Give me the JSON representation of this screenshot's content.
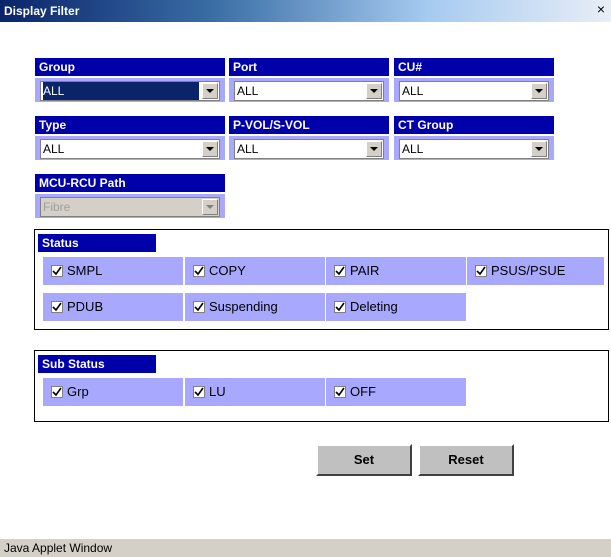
{
  "window": {
    "title": "Display Filter",
    "close_glyph": "×"
  },
  "filters": {
    "group": {
      "label": "Group",
      "value": "ALL"
    },
    "port": {
      "label": "Port",
      "value": "ALL"
    },
    "cu": {
      "label": "CU#",
      "value": "ALL"
    },
    "type": {
      "label": "Type",
      "value": "ALL"
    },
    "pvol": {
      "label": "P-VOL/S-VOL",
      "value": "ALL"
    },
    "ctgroup": {
      "label": "CT Group",
      "value": "ALL"
    },
    "mcu": {
      "label": "MCU-RCU Path",
      "value": "Fibre"
    }
  },
  "status": {
    "label": "Status",
    "items": [
      {
        "label": "SMPL",
        "checked": true
      },
      {
        "label": "COPY",
        "checked": true
      },
      {
        "label": "PAIR",
        "checked": true
      },
      {
        "label": "PSUS/PSUE",
        "checked": true
      },
      {
        "label": "PDUB",
        "checked": true
      },
      {
        "label": "Suspending",
        "checked": true
      },
      {
        "label": "Deleting",
        "checked": true
      }
    ]
  },
  "sub_status": {
    "label": "Sub Status",
    "items": [
      {
        "label": "Grp",
        "checked": true
      },
      {
        "label": "LU",
        "checked": true
      },
      {
        "label": "OFF",
        "checked": true
      }
    ]
  },
  "buttons": {
    "set": "Set",
    "reset": "Reset"
  },
  "statusbar": {
    "text": "Java Applet Window"
  }
}
